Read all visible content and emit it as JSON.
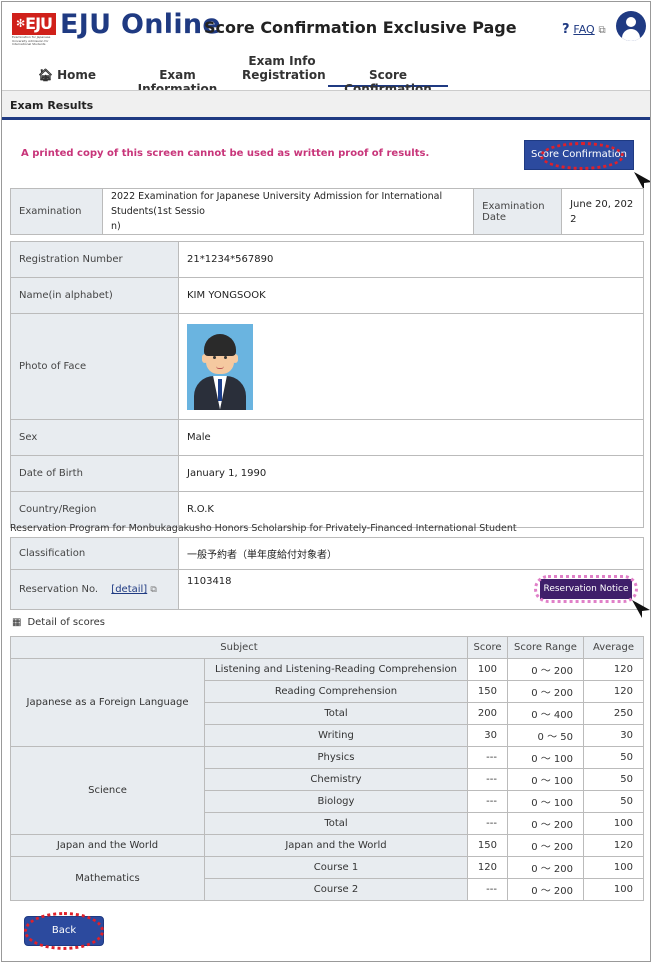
{
  "brand": {
    "logo_text": "EJU",
    "logo_tagline": "Examination for Japanese University Admission for International Students",
    "app_name": "EJU Online",
    "page_name": "Score Confirmation Exclusive Page",
    "faq_label": "FAQ"
  },
  "nav": {
    "home": "Home",
    "exam_info": "Exam Information",
    "exam_reg_line1": "Exam Info",
    "exam_reg_line2": "Registration",
    "score_conf": "Score Confirmation"
  },
  "page_title": "Exam Results",
  "warning": "A printed copy of this screen cannot be used as written proof of results.",
  "score_confirmation_button": "Score Confirmation",
  "exam": {
    "examination_label": "Examination",
    "examination_value_line1": "2022 Examination for Japanese University Admission for International Students(1st Sessio",
    "examination_value_line2": "n)",
    "date_label": "Examination Date",
    "date_value_line1": "June 20, 202",
    "date_value_line2": "2"
  },
  "profile": {
    "registration_label": "Registration Number",
    "registration_value": "21*1234*567890",
    "name_label": "Name(in alphabet)",
    "name_value": "KIM YONGSOOK",
    "photo_label": "Photo of Face",
    "sex_label": "Sex",
    "sex_value": "Male",
    "dob_label": "Date of Birth",
    "dob_value": "January 1, 1990",
    "country_label": "Country/Region",
    "country_value": "R.O.K"
  },
  "reservation": {
    "caption": "Reservation Program for Monbukagakusho Honors Scholarship for Privately-Financed International Student",
    "classification_label": "Classification",
    "classification_value": "一般予約者（単年度給付対象者）",
    "number_label": "Reservation No.",
    "detail_link": "[detail]",
    "number_value": "1103418",
    "notice_button": "Reservation Notice"
  },
  "scores": {
    "caption": "Detail of scores",
    "headers": [
      "Subject",
      "Score",
      "Score Range",
      "Average"
    ],
    "groups": [
      {
        "name": "Japanese as a Foreign Language",
        "rows": [
          {
            "subject": "Listening and Listening-Reading Comprehension",
            "score": "100",
            "range": "0 ～ 200",
            "average": "120"
          },
          {
            "subject": "Reading Comprehension",
            "score": "150",
            "range": "0 ～ 200",
            "average": "120"
          },
          {
            "subject": "Total",
            "score": "200",
            "range": "0 ～ 400",
            "average": "250"
          },
          {
            "subject": "Writing",
            "score": "30",
            "range": "0 ～ 50",
            "average": "30"
          }
        ]
      },
      {
        "name": "Science",
        "rows": [
          {
            "subject": "Physics",
            "score": "---",
            "range": "0 ～ 100",
            "average": "50"
          },
          {
            "subject": "Chemistry",
            "score": "---",
            "range": "0 ～ 100",
            "average": "50"
          },
          {
            "subject": "Biology",
            "score": "---",
            "range": "0 ～ 100",
            "average": "50"
          },
          {
            "subject": "Total",
            "score": "---",
            "range": "0 ～ 200",
            "average": "100"
          }
        ]
      },
      {
        "name": "Japan and the World",
        "rows": [
          {
            "subject": "Japan and the World",
            "score": "150",
            "range": "0 ～ 200",
            "average": "120"
          }
        ]
      },
      {
        "name": "Mathematics",
        "rows": [
          {
            "subject": "Course 1",
            "score": "120",
            "range": "0 ～ 200",
            "average": "100"
          },
          {
            "subject": "Course 2",
            "score": "---",
            "range": "0 ～ 200",
            "average": "100"
          }
        ]
      }
    ]
  },
  "back_button": "Back"
}
